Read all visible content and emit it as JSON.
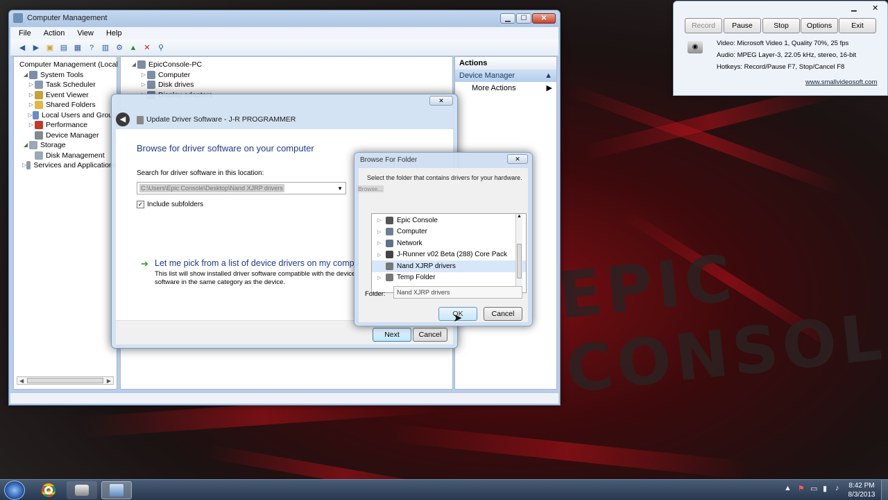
{
  "computer_management": {
    "title": "Computer Management",
    "menu": [
      "File",
      "Action",
      "View",
      "Help"
    ],
    "tree": [
      {
        "label": "Computer Management (Local",
        "expander": "",
        "level": 0,
        "color": "#5d7fa9"
      },
      {
        "label": "System Tools",
        "expander": "◢",
        "level": 1,
        "color": "#7d8ea5"
      },
      {
        "label": "Task Scheduler",
        "expander": "▷",
        "level": 2,
        "color": "#8a9bb1"
      },
      {
        "label": "Event Viewer",
        "expander": "▷",
        "level": 2,
        "color": "#c6a23a"
      },
      {
        "label": "Shared Folders",
        "expander": "▷",
        "level": 2,
        "color": "#e0b849"
      },
      {
        "label": "Local Users and Group",
        "expander": "▷",
        "level": 2,
        "color": "#6b8cc1"
      },
      {
        "label": "Performance",
        "expander": "▷",
        "level": 2,
        "color": "#c0392b"
      },
      {
        "label": "Device Manager",
        "expander": "",
        "level": 2,
        "color": "#7f8c8d"
      },
      {
        "label": "Storage",
        "expander": "◢",
        "level": 1,
        "color": "#9aa8b8"
      },
      {
        "label": "Disk Management",
        "expander": "",
        "level": 2,
        "color": "#9aa8b8"
      },
      {
        "label": "Services and Applications",
        "expander": "▷",
        "level": 1,
        "color": "#8e9aa8"
      }
    ],
    "device_tree": [
      {
        "label": "EpicConsole-PC",
        "expander": "◢",
        "level": 0
      },
      {
        "label": "Computer",
        "expander": "▷",
        "level": 1
      },
      {
        "label": "Disk drives",
        "expander": "▷",
        "level": 1
      },
      {
        "label": "Display adapters",
        "expander": "▷",
        "level": 1
      }
    ],
    "actions": {
      "header": "Actions",
      "section": "Device Manager",
      "item": "More Actions"
    }
  },
  "update_driver": {
    "title": "Update Driver Software - J-R PROGRAMMER",
    "heading": "Browse for driver software on your computer",
    "search_label": "Search for driver software in this location:",
    "path_value": "C:\\Users\\Epic Console\\Desktop\\Nand XJRP drivers",
    "include_subfolders": "Include subfolders",
    "pick_title": "Let me pick from a list of device drivers on my computer",
    "pick_desc_line1": "This list will show installed driver software compatible with the device, and all driver",
    "pick_desc_line2": "software in the same category as the device.",
    "next": "Next",
    "cancel": "Cancel"
  },
  "browse_folder": {
    "title": "Browse For Folder",
    "instruction": "Select the folder that contains drivers for your hardware.",
    "browse_hint": "Browse...",
    "items": [
      {
        "label": "Epic Console",
        "color": "#555"
      },
      {
        "label": "Computer",
        "color": "#6d7f94"
      },
      {
        "label": "Network",
        "color": "#5f7088"
      },
      {
        "label": "J-Runner v02 Beta (288) Core Pack",
        "color": "#444"
      },
      {
        "label": "Nand XJRP drivers",
        "color": "#777"
      },
      {
        "label": "Temp Folder",
        "color": "#777"
      }
    ],
    "folder_label": "Folder:",
    "folder_value": "Nand XJRP drivers",
    "ok": "OK",
    "cancel": "Cancel"
  },
  "recorder": {
    "buttons": [
      "Record",
      "Pause",
      "Stop",
      "Options",
      "Exit"
    ],
    "video": "Video: Microsoft Video 1, Quality 70%, 25 fps",
    "audio": "Audio: MPEG Layer-3, 22.05 kHz, stereo, 16-bit",
    "hotkeys": "Hotkeys: Record/Pause F7, Stop/Cancel F8",
    "link": "www.smallvideosoft.com"
  },
  "taskbar": {
    "time": "8:42 PM",
    "date": "8/3/2013"
  }
}
